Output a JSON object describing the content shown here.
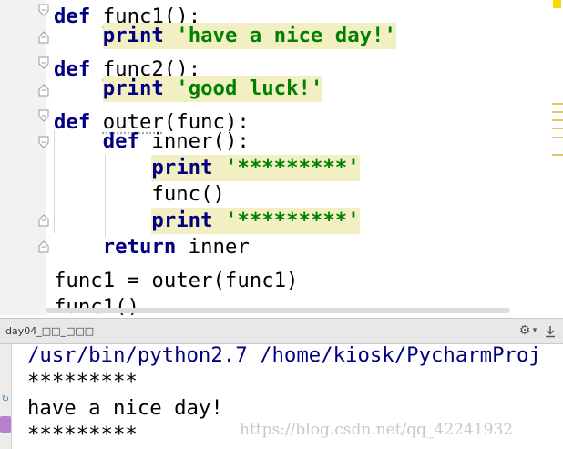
{
  "editor": {
    "lines": [
      {
        "indent": "",
        "tokens": [
          {
            "t": "def",
            "c": "kw"
          },
          {
            "t": " "
          },
          {
            "t": "func1",
            "c": "uline"
          },
          {
            "t": "():"
          }
        ]
      },
      {
        "indent": "    ",
        "tokens": [
          {
            "t": "print",
            "c": "kw hl"
          },
          {
            "t": " ",
            "c": "hl"
          },
          {
            "t": "'have a nice day!'",
            "c": "str hl"
          }
        ]
      },
      {
        "indent": "",
        "tokens": [
          {
            "t": "def",
            "c": "kw"
          },
          {
            "t": " "
          },
          {
            "t": "func2",
            "c": "uline"
          },
          {
            "t": "():"
          }
        ]
      },
      {
        "indent": "    ",
        "tokens": [
          {
            "t": "print",
            "c": "kw hl"
          },
          {
            "t": " ",
            "c": "hl"
          },
          {
            "t": "'good luck!'",
            "c": "str hl"
          }
        ]
      },
      {
        "indent": "",
        "tokens": [
          {
            "t": "def",
            "c": "kw"
          },
          {
            "t": " "
          },
          {
            "t": "outer",
            "c": "uline"
          },
          {
            "t": "(func):"
          }
        ]
      },
      {
        "indent": "    ",
        "tokens": [
          {
            "t": "def",
            "c": "kw"
          },
          {
            "t": " inner():"
          }
        ]
      },
      {
        "indent": "        ",
        "tokens": [
          {
            "t": "print",
            "c": "kw hl"
          },
          {
            "t": " ",
            "c": "hl"
          },
          {
            "t": "'*********'",
            "c": "str hl"
          }
        ]
      },
      {
        "indent": "        ",
        "tokens": [
          {
            "t": "func()"
          }
        ]
      },
      {
        "indent": "        ",
        "tokens": [
          {
            "t": "print",
            "c": "kw hl"
          },
          {
            "t": " ",
            "c": "hl"
          },
          {
            "t": "'*********'",
            "c": "str hl"
          }
        ]
      },
      {
        "indent": "    ",
        "tokens": [
          {
            "t": "return",
            "c": "kw"
          },
          {
            "t": " inner"
          }
        ]
      },
      {
        "indent": "",
        "tokens": [
          {
            "t": "func1 = outer(func1)"
          }
        ]
      },
      {
        "indent": "",
        "tokens": [
          {
            "t": "func1()"
          }
        ]
      }
    ],
    "fold_markers": [
      {
        "name": "fold-func1",
        "kind": "open"
      },
      {
        "name": "fold-func1-end",
        "kind": "close"
      },
      {
        "name": "fold-func2",
        "kind": "open"
      },
      {
        "name": "fold-func2-end",
        "kind": "close"
      },
      {
        "name": "fold-outer",
        "kind": "open"
      },
      {
        "name": "fold-inner",
        "kind": "open"
      },
      {
        "name": "fold-inner-end",
        "kind": "close"
      },
      {
        "name": "fold-outer-end",
        "kind": "close"
      }
    ]
  },
  "run_panel": {
    "title": "day04_□□_□□□",
    "settings_icon": "gear-icon",
    "pin_icon": "pin-icon",
    "console_lines": [
      {
        "text": "/usr/bin/python2.7 /home/kiosk/PycharmProj",
        "kind": "cmd"
      },
      {
        "text": "*********",
        "kind": "out"
      },
      {
        "text": "have a nice day!",
        "kind": "out"
      },
      {
        "text": "*********",
        "kind": "out"
      }
    ]
  },
  "watermark": "https://blog.csdn.net/qq_42241932",
  "colors": {
    "keyword": "#000080",
    "string": "#008000",
    "highlight": "#f2f0c2",
    "gutter": "#f2f2f2"
  }
}
